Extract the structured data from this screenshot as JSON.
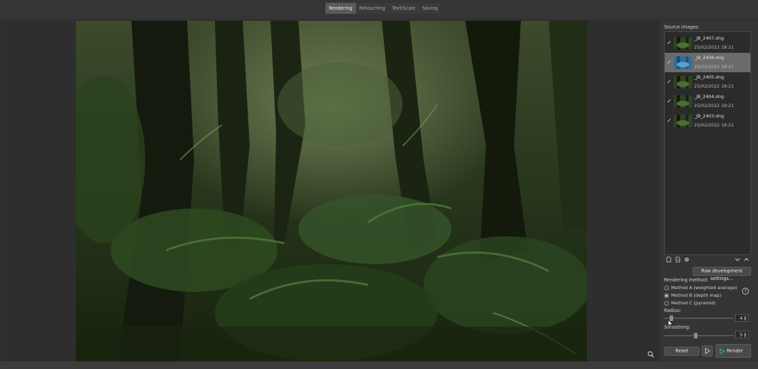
{
  "tabs": [
    {
      "label": "Rendering",
      "active": true
    },
    {
      "label": "Retouching",
      "active": false
    },
    {
      "label": "Text/Scale",
      "active": false
    },
    {
      "label": "Saving",
      "active": false
    }
  ],
  "sidebar": {
    "source_images_label": "Source images:",
    "images": [
      {
        "name": "_JB_2407.dng",
        "date": "25/02/2022 18:21",
        "checked": true,
        "selected": false
      },
      {
        "name": "_JB_2406.dng",
        "date": "25/02/2022 18:21",
        "checked": true,
        "selected": true
      },
      {
        "name": "_JB_2405.dng",
        "date": "25/02/2022 18:21",
        "checked": true,
        "selected": false
      },
      {
        "name": "_JB_2404.dng",
        "date": "25/02/2022 18:21",
        "checked": true,
        "selected": false
      },
      {
        "name": "_JB_2403.dng",
        "date": "25/02/2022 18:21",
        "checked": true,
        "selected": false
      }
    ],
    "check_glyph": "✓",
    "raw_dev_button": "Raw development settings...",
    "rendering_method_label": "Rendering method:",
    "methods": [
      {
        "label": "Method A (weighted average)",
        "selected": false
      },
      {
        "label": "Method B (depth map)",
        "selected": true
      },
      {
        "label": "Method C (pyramid)",
        "selected": false
      }
    ],
    "help_glyph": "?",
    "radius_label": "Radius:",
    "radius_value": "4",
    "radius_level": 0.08,
    "smoothing_label": "Smoothing:",
    "smoothing_value": "5",
    "smoothing_level": 0.45,
    "reset_button": "Reset",
    "render_button": "Render",
    "spin_up": "▲",
    "spin_down": "▼"
  },
  "icons": {
    "add_file": "add-file-icon",
    "remove_file": "remove-file-icon",
    "settings": "settings-icon",
    "move_down": "chevron-down-icon",
    "move_up": "chevron-up-icon",
    "play": "play-icon",
    "zoom": "zoom-icon"
  },
  "colors": {
    "accent_green": "#3bb34a",
    "selected_row": "#6b6b6b",
    "active_tab": "#5a5a5a"
  }
}
